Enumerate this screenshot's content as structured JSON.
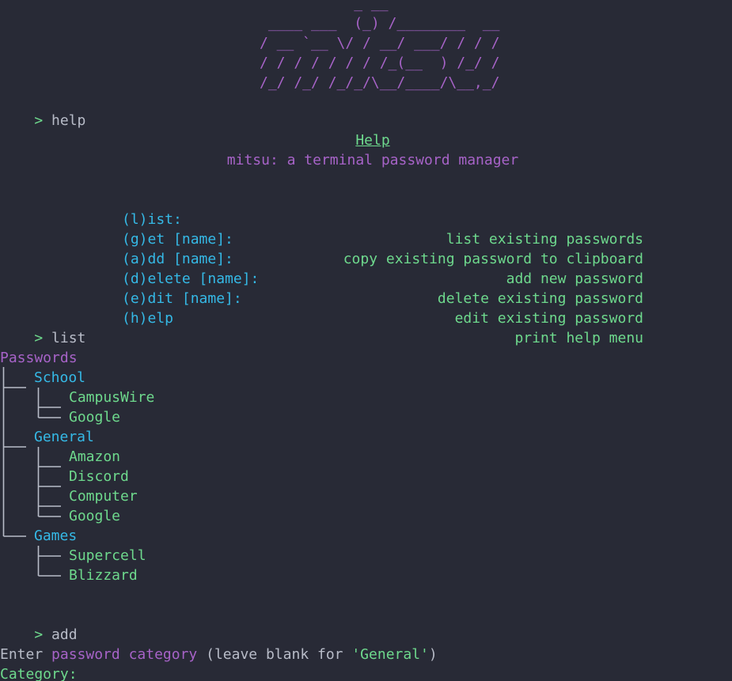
{
  "logo": "           _ __\n ____ ___  (_) /________  __\n/ __ `__ \\/ / __/ ___/ / / /\n/ / / / / / / /_(__  ) /_/ /\n/_/ /_/ /_/_/\\__/____/\\__,_/",
  "prompt_symbol": ">",
  "commands": {
    "help": "help",
    "list": "list",
    "add": "add"
  },
  "help": {
    "title": "Help",
    "subtitle": "mitsu: a terminal password manager",
    "rows": [
      {
        "command": "(l)ist:",
        "description": "list existing passwords"
      },
      {
        "command": "(g)et [name]:",
        "description": "copy existing password to clipboard"
      },
      {
        "command": "(a)dd [name]:",
        "description": "add new password"
      },
      {
        "command": "(d)elete [name]:",
        "description": "delete existing password"
      },
      {
        "command": "(e)dit [name]:",
        "description": "edit existing password"
      },
      {
        "command": "(h)elp",
        "description": "print help menu"
      }
    ]
  },
  "tree": {
    "root": "Passwords",
    "categories": [
      {
        "name": "School",
        "items": [
          "CampusWire",
          "Google"
        ]
      },
      {
        "name": "General",
        "items": [
          "Amazon",
          "Discord",
          "Computer",
          "Google"
        ]
      },
      {
        "name": "Games",
        "items": [
          "Supercell",
          "Blizzard"
        ]
      }
    ]
  },
  "add_prompt": {
    "enter": "Enter",
    "password_category": "password category",
    "leave_blank": "(leave blank for",
    "default_value": "'General'",
    "close_paren": ")",
    "category_label": "Category:"
  },
  "colors": {
    "background": "#282a36",
    "purple": "#a763c8",
    "green": "#6ed98d",
    "cyan": "#35b9e6",
    "text": "#b8bcc8"
  }
}
